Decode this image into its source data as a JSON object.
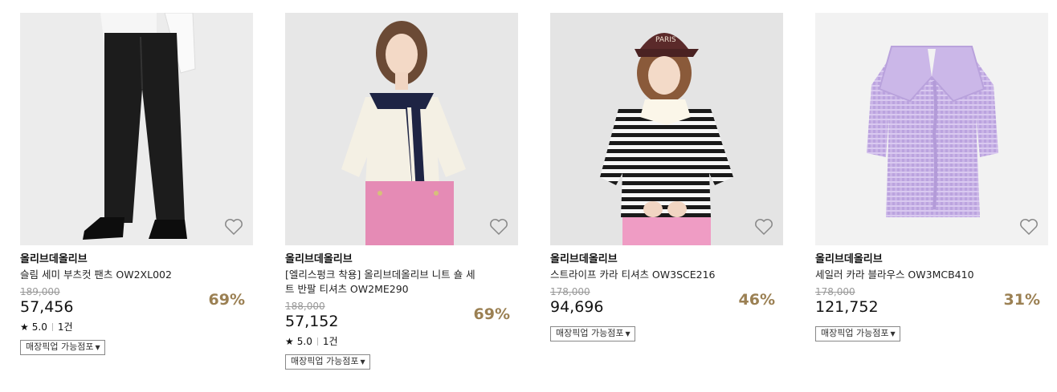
{
  "products": [
    {
      "brand": "올리브데올리브",
      "name": "슬림 세미 부츠컷 팬츠 OW2XL002",
      "original_price": "189,000",
      "price": "57,456",
      "discount": "69%",
      "rating": "5.0",
      "reviews": "1건",
      "pickup_label": "매장픽업 가능점포",
      "image_icon": "pants-image"
    },
    {
      "brand": "올리브데올리브",
      "name": "[엘리스펑크 착용] 올리브데올리브 니트 숄 세트 반팔 티셔츠 OW2ME290",
      "original_price": "188,000",
      "price": "57,152",
      "discount": "69%",
      "rating": "5.0",
      "reviews": "1건",
      "pickup_label": "매장픽업 가능점포",
      "image_icon": "shawl-tshirt-image"
    },
    {
      "brand": "올리브데올리브",
      "name": "스트라이프 카라 티셔츠 OW3SCE216",
      "original_price": "178,000",
      "price": "94,696",
      "discount": "46%",
      "pickup_label": "매장픽업 가능점포",
      "image_icon": "stripe-tshirt-image",
      "cap_text": "PARIS"
    },
    {
      "brand": "올리브데올리브",
      "name": "세일러 카라 블라우스 OW3MCB410",
      "original_price": "178,000",
      "price": "121,752",
      "discount": "31%",
      "pickup_label": "매장픽업 가능점포",
      "image_icon": "sailor-blouse-image"
    }
  ],
  "colors": {
    "discount": "#9b8053",
    "original_price": "#999999"
  }
}
